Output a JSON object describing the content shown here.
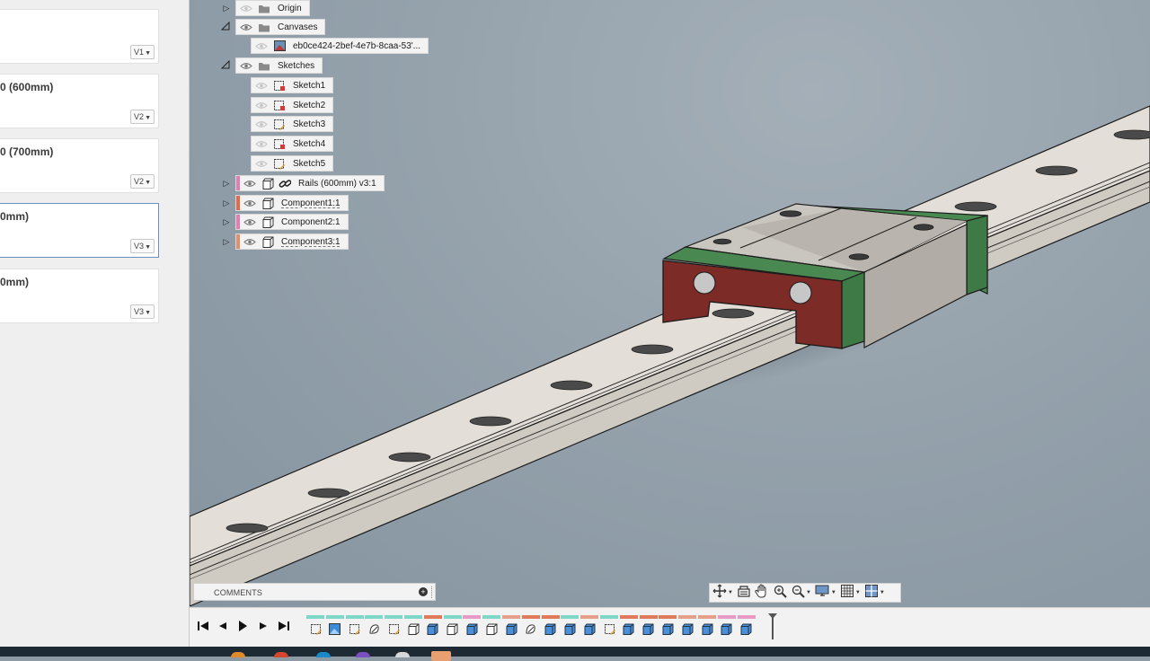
{
  "left_panel": {
    "cards": [
      {
        "title": "",
        "version": "V1",
        "selected": false
      },
      {
        "title": "0 (600mm)",
        "version": "V2",
        "selected": false
      },
      {
        "title": "0 (700mm)",
        "version": "V2",
        "selected": false
      },
      {
        "title": "0mm)",
        "version": "V3",
        "selected": true
      },
      {
        "title": "0mm)",
        "version": "V3",
        "selected": false
      }
    ]
  },
  "browser": {
    "nodes": [
      {
        "label": "Origin",
        "kind": "folder",
        "expander": "collapsed",
        "eye": "hidden"
      },
      {
        "label": "Canvases",
        "kind": "folder",
        "expander": "expanded",
        "eye": "visible"
      },
      {
        "label": "eb0ce424-2bef-4e7b-8caa-53'...",
        "kind": "canvas",
        "expander": "",
        "eye": "hidden"
      },
      {
        "label": "Sketches",
        "kind": "folder",
        "expander": "expanded",
        "eye": "visible"
      },
      {
        "label": "Sketch1",
        "kind": "sketch-locked",
        "expander": "",
        "eye": "hidden"
      },
      {
        "label": "Sketch2",
        "kind": "sketch-locked",
        "expander": "",
        "eye": "hidden"
      },
      {
        "label": "Sketch3",
        "kind": "sketch",
        "expander": "",
        "eye": "hidden"
      },
      {
        "label": "Sketch4",
        "kind": "sketch-locked",
        "expander": "",
        "eye": "hidden"
      },
      {
        "label": "Sketch5",
        "kind": "sketch",
        "expander": "",
        "eye": "hidden"
      },
      {
        "label": "Rails (600mm) v3:1",
        "kind": "linked-component",
        "expander": "collapsed",
        "eye": "visible",
        "color": "#e07fb2"
      },
      {
        "label": "Component1:1",
        "kind": "component",
        "expander": "collapsed",
        "eye": "visible",
        "color": "#e06a4a"
      },
      {
        "label": "Component2:1",
        "kind": "component",
        "expander": "collapsed",
        "eye": "visible",
        "color": "#e07fb2"
      },
      {
        "label": "Component3:1",
        "kind": "component",
        "expander": "collapsed",
        "eye": "visible",
        "color": "#e0906a"
      }
    ]
  },
  "comments": {
    "label": "COMMENTS"
  },
  "navigation_bar": {
    "tools": [
      "orbit-icon",
      "look-at-icon",
      "pan-icon",
      "zoom-window-icon",
      "zoom-icon",
      "display-settings-icon",
      "grid-icon",
      "viewports-icon"
    ]
  },
  "timeline": {
    "controls": [
      "skip-to-start",
      "step-back",
      "play",
      "step-forward",
      "skip-to-end"
    ],
    "items": [
      {
        "kind": "sketch",
        "bar": "#7dd8c8"
      },
      {
        "kind": "canvas",
        "bar": "#7dd8c8"
      },
      {
        "kind": "sketch",
        "bar": "#7dd8c8"
      },
      {
        "kind": "form",
        "bar": "#7dd8c8"
      },
      {
        "kind": "sketch",
        "bar": "#7dd8c8"
      },
      {
        "kind": "body",
        "bar": "#7dd8c8"
      },
      {
        "kind": "extrude",
        "bar": "#e07a5a"
      },
      {
        "kind": "body",
        "bar": "#7dd8c8"
      },
      {
        "kind": "extrude",
        "bar": "#e79ac6"
      },
      {
        "kind": "body",
        "bar": "#7dd8c8"
      },
      {
        "kind": "extrude",
        "bar": "#e6a08a"
      },
      {
        "kind": "form",
        "bar": "#e07a5a"
      },
      {
        "kind": "extrude",
        "bar": "#e07a5a"
      },
      {
        "kind": "extrude",
        "bar": "#7dd8c8"
      },
      {
        "kind": "extrude",
        "bar": "#e6a08a"
      },
      {
        "kind": "sketch",
        "bar": "#7dd8c8"
      },
      {
        "kind": "extrude",
        "bar": "#e07a5a"
      },
      {
        "kind": "extrude",
        "bar": "#e07a5a"
      },
      {
        "kind": "extrude",
        "bar": "#e07a5a"
      },
      {
        "kind": "extrude",
        "bar": "#e6a08a"
      },
      {
        "kind": "extrude",
        "bar": "#e6a08a"
      },
      {
        "kind": "extrude",
        "bar": "#e79ac6"
      },
      {
        "kind": "extrude",
        "bar": "#e79ac6"
      }
    ]
  },
  "colors": {
    "rail": "#dedad2",
    "block_body": "#c6c3bc",
    "end_cap_red": "#7d2b26",
    "end_seal_green": "#3d7a45"
  }
}
